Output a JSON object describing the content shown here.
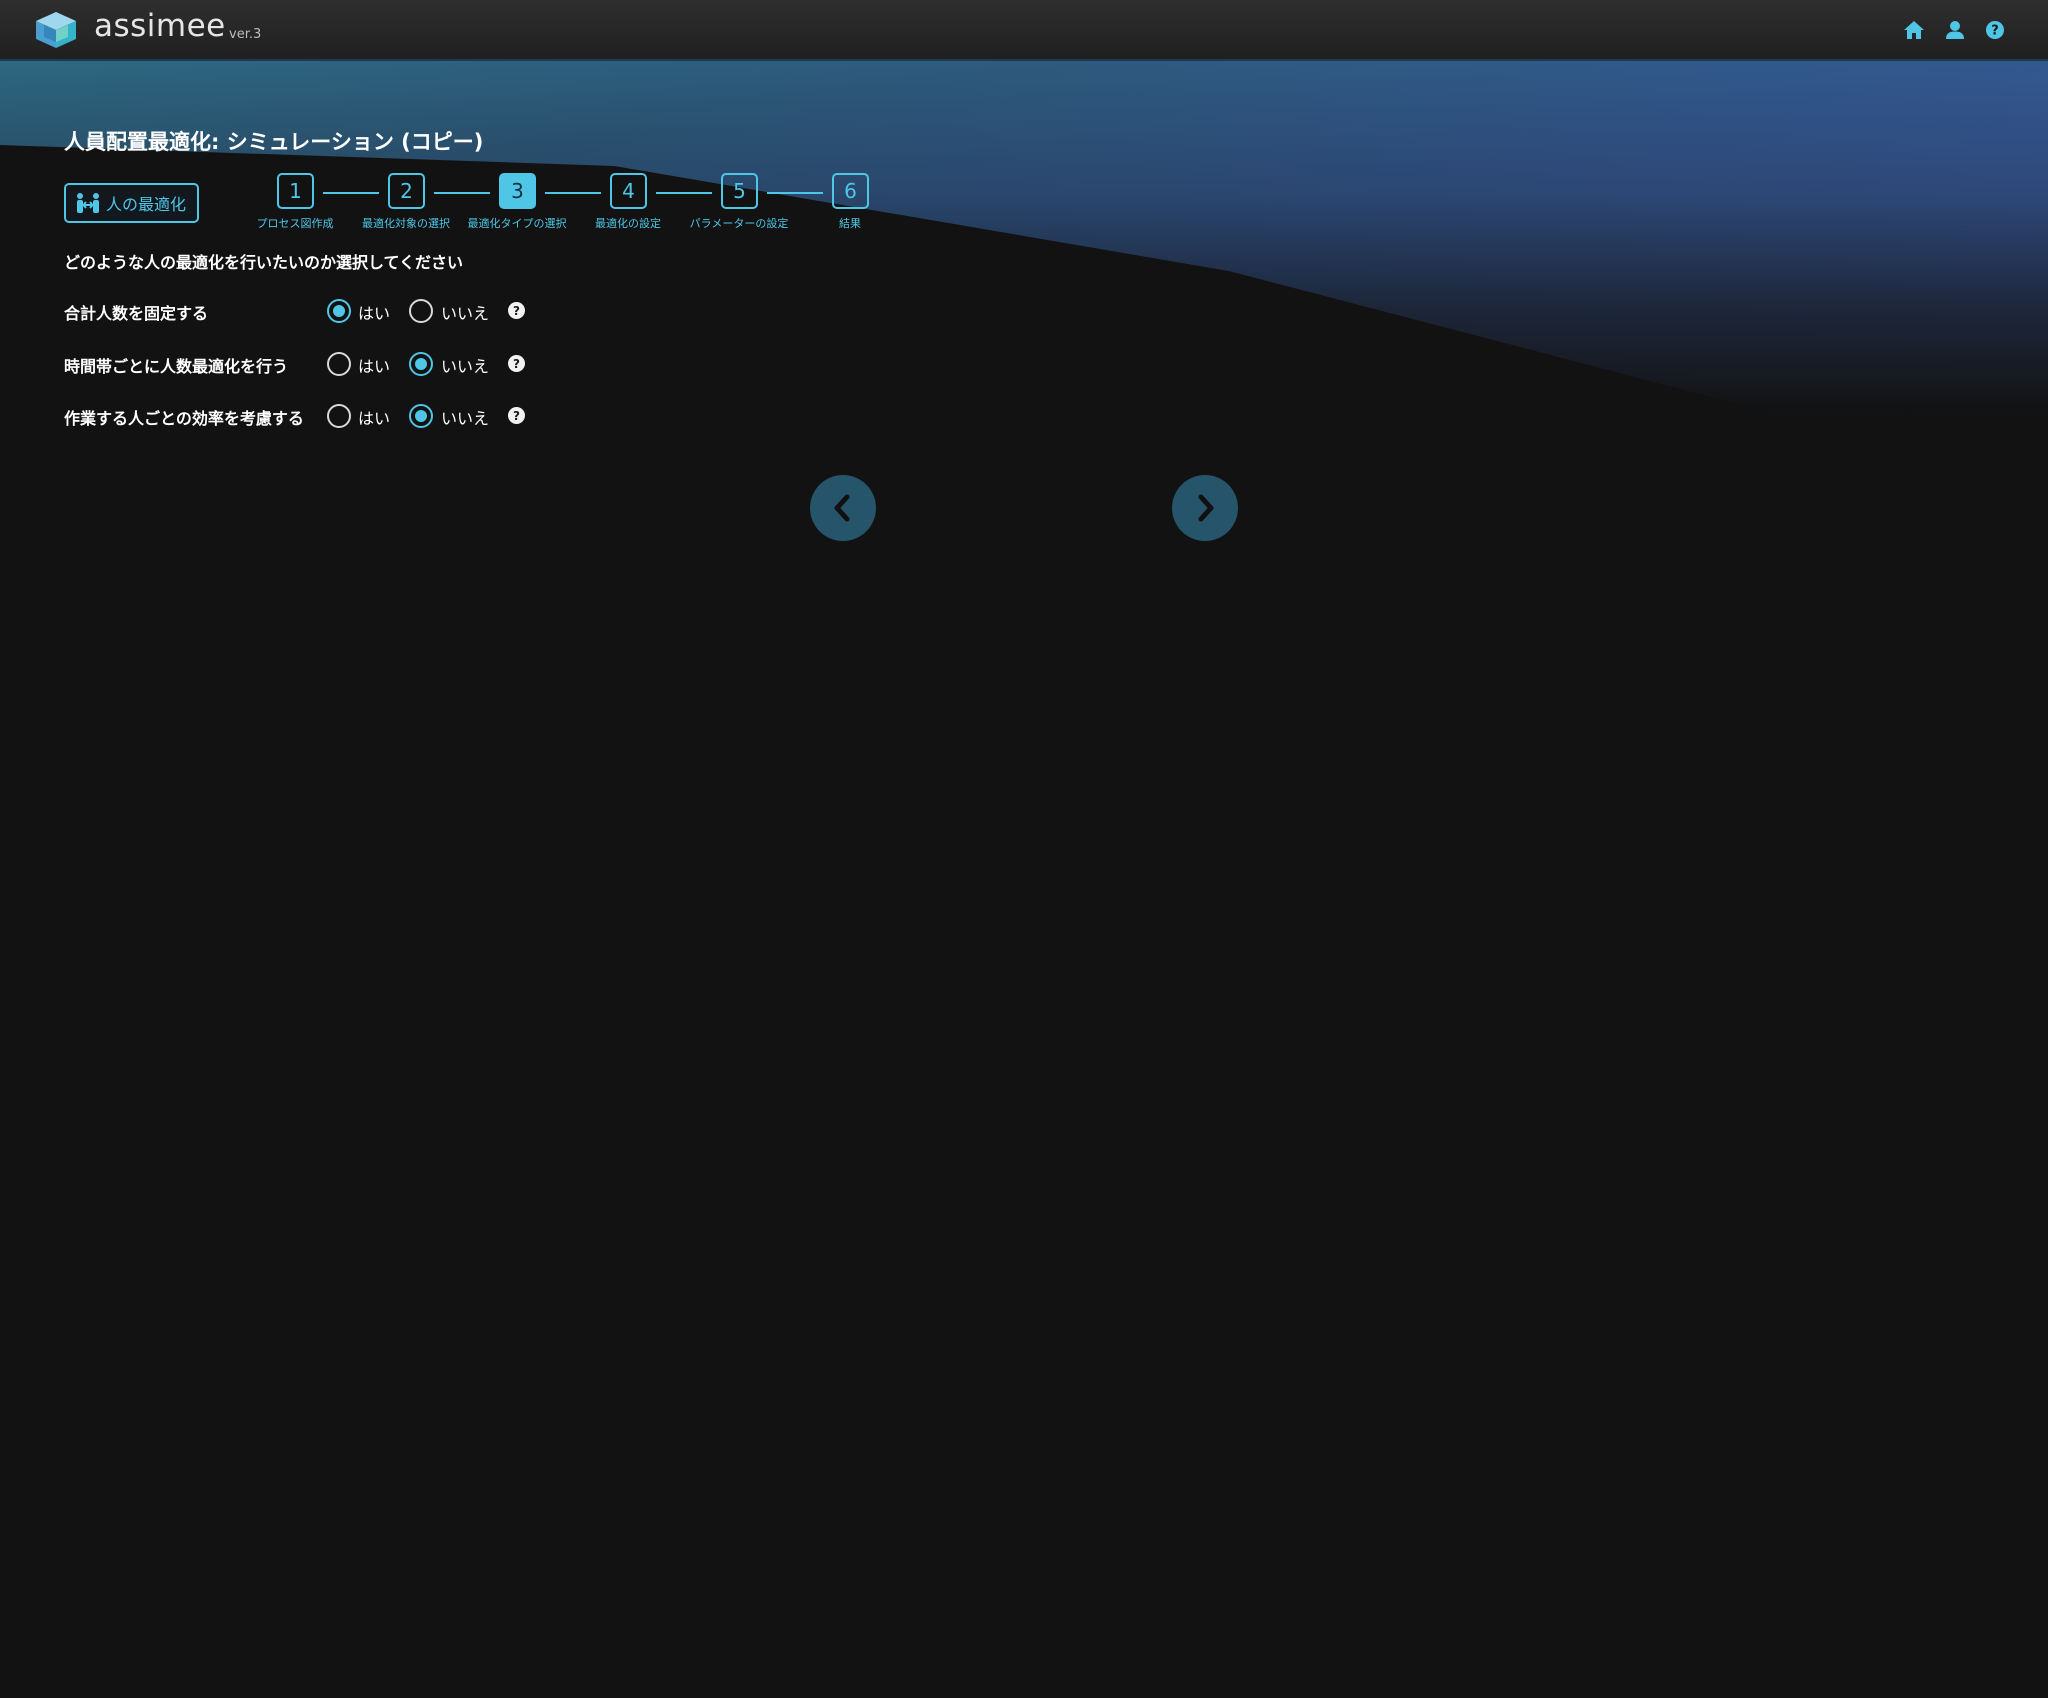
{
  "header": {
    "app_name": "assimee",
    "version": "ver.3",
    "icons": [
      "home-icon",
      "user-icon",
      "help-icon"
    ],
    "accent_color": "#4fc6e6"
  },
  "page": {
    "title": "人員配置最適化: シミュレーション (コピー)",
    "mode_badge": "人の最適化",
    "instruction": "どのような人の最適化を行いたいのか選択してください"
  },
  "stepper": {
    "current_step": 3,
    "steps": [
      {
        "number": "1",
        "label": "プロセス図作成"
      },
      {
        "number": "2",
        "label": "最適化対象の選択"
      },
      {
        "number": "3",
        "label": "最適化タイプの選択"
      },
      {
        "number": "4",
        "label": "最適化の設定"
      },
      {
        "number": "5",
        "label": "パラメーターの設定"
      },
      {
        "number": "6",
        "label": "結果"
      }
    ]
  },
  "questions": [
    {
      "label": "合計人数を固定する",
      "yes_label": "はい",
      "no_label": "いいえ",
      "selected": "yes"
    },
    {
      "label": "時間帯ごとに人数最適化を行う",
      "yes_label": "はい",
      "no_label": "いいえ",
      "selected": "no"
    },
    {
      "label": "作業する人ごとの効率を考慮する",
      "yes_label": "はい",
      "no_label": "いいえ",
      "selected": "no"
    }
  ],
  "help_glyph": "?",
  "navigation": {
    "back_icon": "chevron-left-icon",
    "next_icon": "chevron-right-icon"
  }
}
